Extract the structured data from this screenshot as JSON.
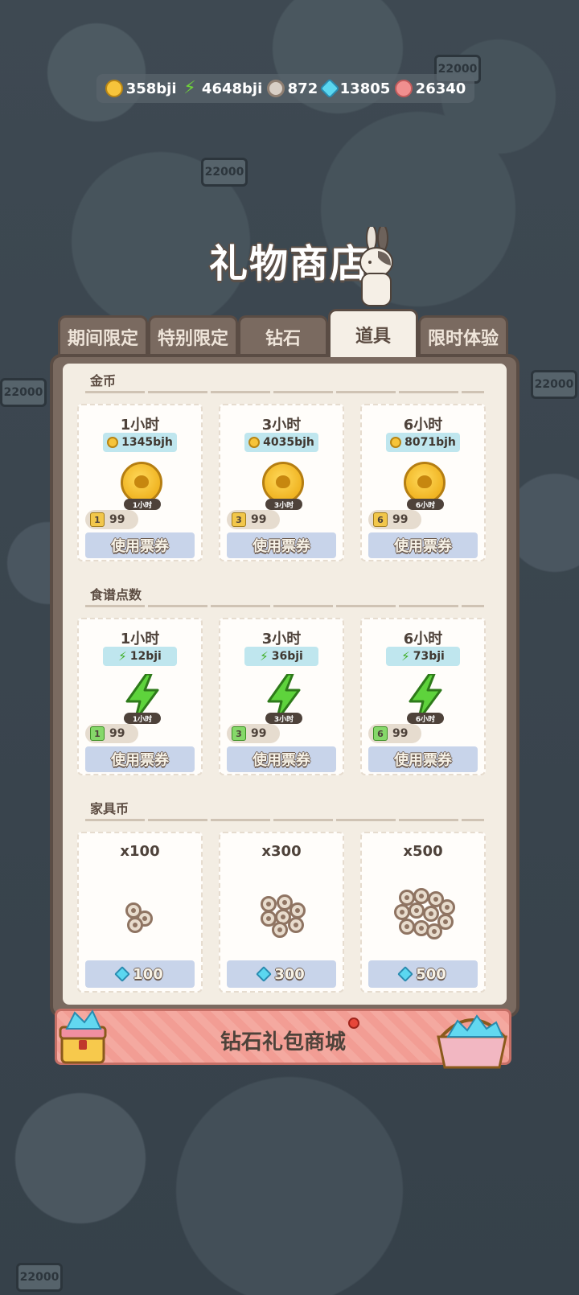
{
  "resources": [
    {
      "icon": "coin-icon",
      "value": "358bji"
    },
    {
      "icon": "bolt-icon",
      "value": "4648bji"
    },
    {
      "icon": "nut-icon",
      "value": "872"
    },
    {
      "icon": "gem-icon",
      "value": "13805"
    },
    {
      "icon": "shell-icon",
      "value": "26340"
    }
  ],
  "title": "礼物商店",
  "tabs": [
    {
      "label": "期间限定",
      "active": false
    },
    {
      "label": "特别限定",
      "active": false
    },
    {
      "label": "钻石",
      "active": false
    },
    {
      "label": "道具",
      "active": true
    },
    {
      "label": "限时体验",
      "active": false
    }
  ],
  "sections": {
    "gold": {
      "title": "金币",
      "items": [
        {
          "duration": "1小时",
          "amount": "1345bjh",
          "tag": "1小时",
          "ticket_num": "1",
          "ticket_count": "99",
          "button": "使用票券"
        },
        {
          "duration": "3小时",
          "amount": "4035bjh",
          "tag": "3小时",
          "ticket_num": "3",
          "ticket_count": "99",
          "button": "使用票券"
        },
        {
          "duration": "6小时",
          "amount": "8071bjh",
          "tag": "6小时",
          "ticket_num": "6",
          "ticket_count": "99",
          "button": "使用票券"
        }
      ]
    },
    "recipe": {
      "title": "食谱点数",
      "items": [
        {
          "duration": "1小时",
          "amount": "12bji",
          "tag": "1小时",
          "ticket_num": "1",
          "ticket_count": "99",
          "button": "使用票券"
        },
        {
          "duration": "3小时",
          "amount": "36bji",
          "tag": "3小时",
          "ticket_num": "3",
          "ticket_count": "99",
          "button": "使用票券"
        },
        {
          "duration": "6小时",
          "amount": "73bji",
          "tag": "6小时",
          "ticket_num": "6",
          "ticket_count": "99",
          "button": "使用票券"
        }
      ]
    },
    "furniture": {
      "title": "家具币",
      "items": [
        {
          "qty": "x100",
          "price": "100"
        },
        {
          "qty": "x300",
          "price": "300"
        },
        {
          "qty": "x500",
          "price": "500"
        }
      ]
    }
  },
  "banner": {
    "label": "钻石礼包商城"
  },
  "bg_signs": [
    "22000",
    "22000",
    "22000",
    "22000",
    "22000"
  ],
  "colors": {
    "tab_active": "#f5efe6",
    "tab": "#7a6a60",
    "button": "#c8d4ea",
    "banner": "#f4a9a0"
  }
}
